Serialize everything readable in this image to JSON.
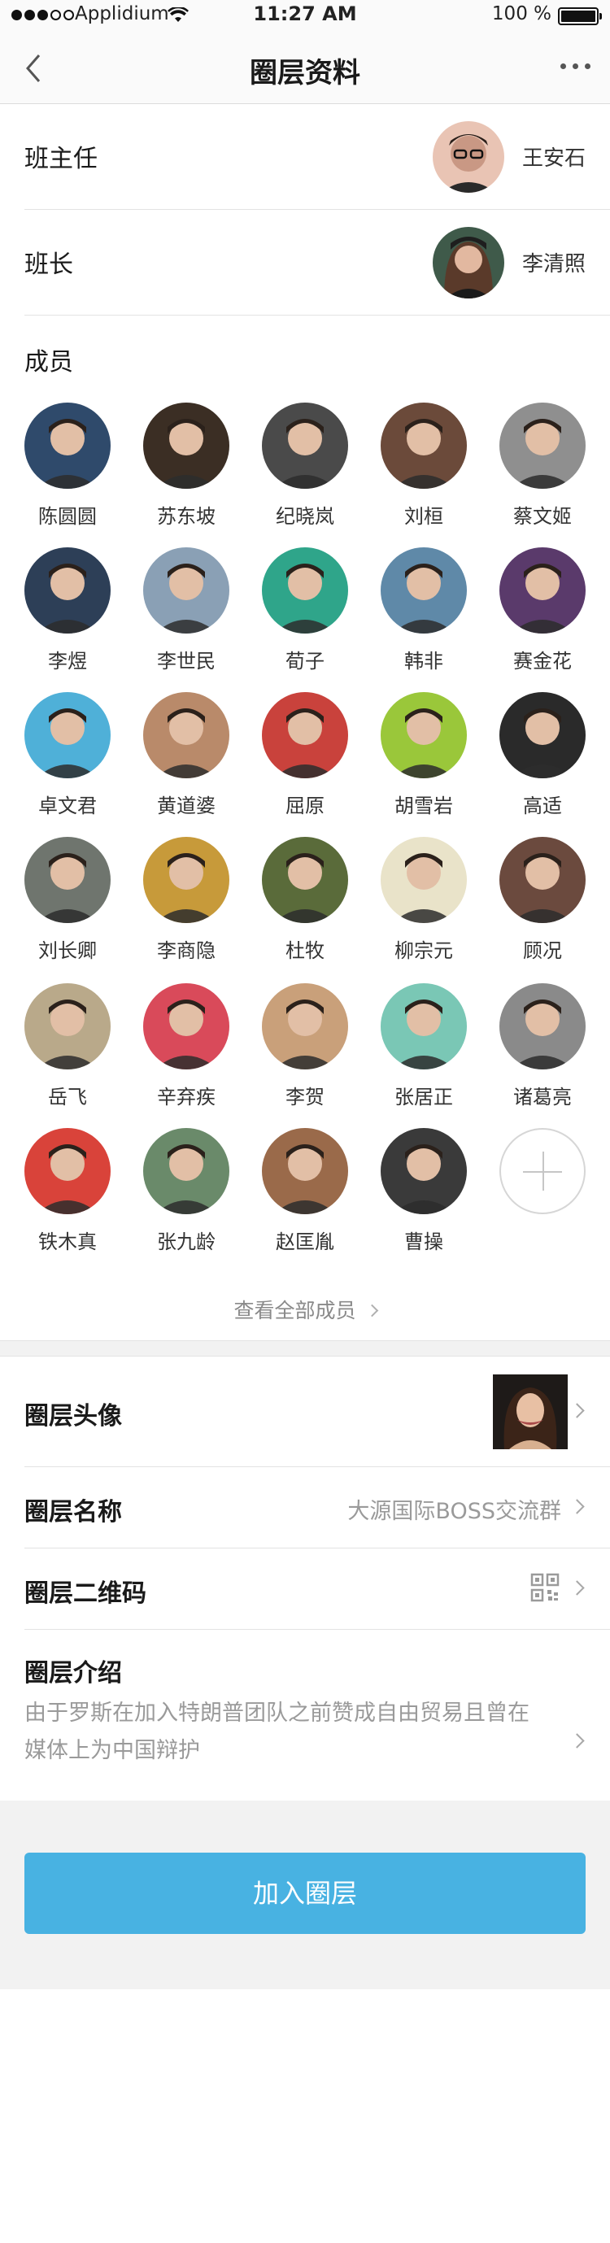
{
  "status_bar": {
    "carrier": "Applidium",
    "time": "11:27 AM",
    "battery": "100 %"
  },
  "nav": {
    "title": "圈层资料",
    "back_icon": "chevron-left-icon",
    "more_icon": "ellipsis-icon"
  },
  "leaders": [
    {
      "role": "班主任",
      "name": "王安石"
    },
    {
      "role": "班长",
      "name": "李清照"
    }
  ],
  "members_title": "成员",
  "members": [
    {
      "name": "陈圆圆",
      "color": "#2f4a6b"
    },
    {
      "name": "苏东坡",
      "color": "#3b2e24"
    },
    {
      "name": "纪晓岚",
      "color": "#4a4a4a"
    },
    {
      "name": "刘桓",
      "color": "#6b4a3a"
    },
    {
      "name": "蔡文姬",
      "color": "#8f8f8f"
    },
    {
      "name": "李煜",
      "color": "#2d3f57"
    },
    {
      "name": "李世民",
      "color": "#8aa0b5"
    },
    {
      "name": "荀子",
      "color": "#2fa58a"
    },
    {
      "name": "韩非",
      "color": "#5f89a8"
    },
    {
      "name": "赛金花",
      "color": "#5a3a6b"
    },
    {
      "name": "卓文君",
      "color": "#4fb0d8"
    },
    {
      "name": "黄道婆",
      "color": "#b98a6a"
    },
    {
      "name": "屈原",
      "color": "#c9423c"
    },
    {
      "name": "胡雪岩",
      "color": "#9ac73a"
    },
    {
      "name": "高适",
      "color": "#2a2a2a"
    },
    {
      "name": "刘长卿",
      "color": "#6f756e"
    },
    {
      "name": "李商隐",
      "color": "#c79a3a"
    },
    {
      "name": "杜牧",
      "color": "#5a6b3a"
    },
    {
      "name": "柳宗元",
      "color": "#e9e3c9"
    },
    {
      "name": "顾况",
      "color": "#6b4a3e"
    },
    {
      "name": "岳飞",
      "color": "#b9a98a"
    },
    {
      "name": "辛弃疾",
      "color": "#d94a5a"
    },
    {
      "name": "李贺",
      "color": "#c9a07a"
    },
    {
      "name": "张居正",
      "color": "#7ac7b5"
    },
    {
      "name": "诸葛亮",
      "color": "#8a8a8a"
    },
    {
      "name": "铁木真",
      "color": "#d9433a"
    },
    {
      "name": "张九龄",
      "color": "#6a8a6a"
    },
    {
      "name": "赵匡胤",
      "color": "#9a6a4a"
    },
    {
      "name": "曹操",
      "color": "#3a3a3a"
    }
  ],
  "add_member_icon": "plus-icon",
  "view_all": "查看全部成员",
  "settings": {
    "avatar_label": "圈层头像",
    "name_label": "圈层名称",
    "name_value": "大源国际BOSS交流群",
    "qr_label": "圈层二维码",
    "qr_icon": "qr-code-icon",
    "intro_label": "圈层介绍",
    "intro_text": "由于罗斯在加入特朗普团队之前赞成自由贸易且曾在媒体上为中国辩护"
  },
  "join_button": "加入圈层",
  "colors": {
    "accent": "#48b2e2",
    "background_band": "#f2f2f2",
    "divider": "#e3e3e3"
  }
}
